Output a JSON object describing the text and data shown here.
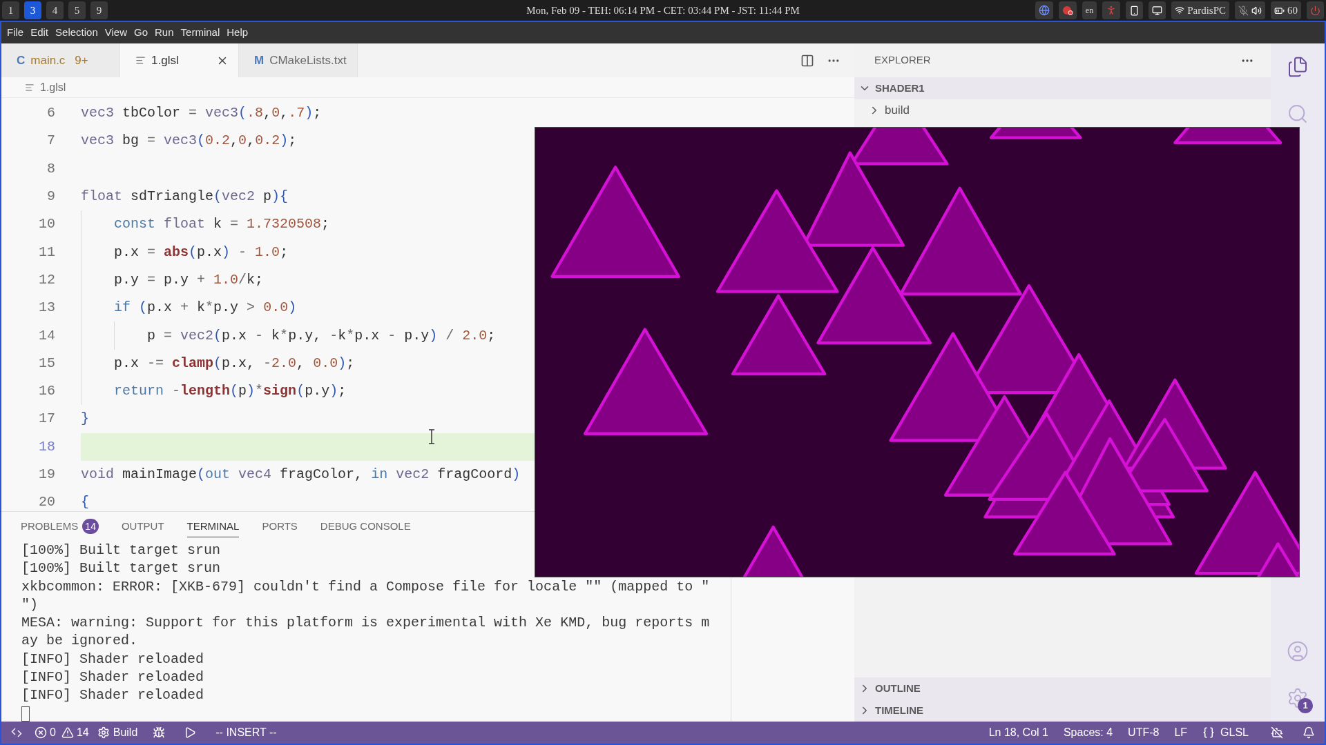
{
  "top_bar": {
    "workspaces": [
      {
        "label": "1",
        "selected": false
      },
      {
        "label": "3",
        "selected": true
      },
      {
        "label": "4",
        "selected": false
      },
      {
        "label": "5",
        "selected": false
      },
      {
        "label": "9",
        "selected": false
      }
    ],
    "clock": "Mon, Feb 09 - TEH: 06:14 PM - CET: 03:44 PM - JST: 11:44 PM",
    "keyboard_layout": "en",
    "network": "PardisPC",
    "battery": "60"
  },
  "menu": [
    "File",
    "Edit",
    "Selection",
    "View",
    "Go",
    "Run",
    "Terminal",
    "Help"
  ],
  "editor": {
    "tabs": [
      {
        "kind": "letter",
        "icon": "C",
        "label": "main.c",
        "badge": "9+",
        "has_problems": true,
        "selected": false
      },
      {
        "kind": "lines",
        "label": "1.glsl",
        "has_problems": false,
        "selected": true
      },
      {
        "kind": "letter",
        "icon": "M",
        "label": "CMakeLists.txt",
        "has_problems": false,
        "selected": false
      }
    ],
    "breadcrumb": "1.glsl",
    "lines": [
      {
        "number": "6",
        "current": false,
        "tokens": [
          {
            "text": "vec3",
            "kind": "type"
          },
          {
            "text": " tbColor ",
            "kind": "ident"
          },
          {
            "text": "= ",
            "kind": "op"
          },
          {
            "text": "vec3",
            "kind": "type"
          },
          {
            "text": "(",
            "kind": "bracket"
          },
          {
            "text": ".8",
            "kind": "number"
          },
          {
            "text": ",",
            "kind": "punct"
          },
          {
            "text": "0",
            "kind": "number"
          },
          {
            "text": ",",
            "kind": "punct"
          },
          {
            "text": ".7",
            "kind": "number"
          },
          {
            "text": ")",
            "kind": "bracket"
          },
          {
            "text": ";",
            "kind": "punct"
          }
        ]
      },
      {
        "number": "7",
        "current": false,
        "tokens": [
          {
            "text": "vec3",
            "kind": "type"
          },
          {
            "text": " bg ",
            "kind": "ident"
          },
          {
            "text": "= ",
            "kind": "op"
          },
          {
            "text": "vec3",
            "kind": "type"
          },
          {
            "text": "(",
            "kind": "bracket"
          },
          {
            "text": "0.2",
            "kind": "number"
          },
          {
            "text": ",",
            "kind": "punct"
          },
          {
            "text": "0",
            "kind": "number"
          },
          {
            "text": ",",
            "kind": "punct"
          },
          {
            "text": "0.2",
            "kind": "number"
          },
          {
            "text": ")",
            "kind": "bracket"
          },
          {
            "text": ";",
            "kind": "punct"
          }
        ]
      },
      {
        "number": "8",
        "current": false
      },
      {
        "number": "9",
        "current": false,
        "tokens": [
          {
            "text": "float",
            "kind": "type"
          },
          {
            "text": " sdTriangle",
            "kind": "ident"
          },
          {
            "text": "(",
            "kind": "bracket"
          },
          {
            "text": "vec2",
            "kind": "type"
          },
          {
            "text": " p",
            "kind": "ident"
          },
          {
            "text": "){",
            "kind": "bracket"
          }
        ],
        "children": [
          {
            "number": "10",
            "current": false,
            "tokens": [
              {
                "text": "const ",
                "kind": "keyword"
              },
              {
                "text": "float",
                "kind": "type"
              },
              {
                "text": " k ",
                "kind": "ident"
              },
              {
                "text": "= ",
                "kind": "op"
              },
              {
                "text": "1.7320508",
                "kind": "number"
              },
              {
                "text": ";",
                "kind": "punct"
              }
            ]
          },
          {
            "number": "11",
            "current": false,
            "tokens": [
              {
                "text": "p.x ",
                "kind": "ident"
              },
              {
                "text": "= ",
                "kind": "op"
              },
              {
                "text": "abs",
                "kind": "builtin"
              },
              {
                "text": "(",
                "kind": "bracket"
              },
              {
                "text": "p.x",
                "kind": "ident"
              },
              {
                "text": ")",
                "kind": "bracket"
              },
              {
                "text": " - ",
                "kind": "op"
              },
              {
                "text": "1.0",
                "kind": "number"
              },
              {
                "text": ";",
                "kind": "punct"
              }
            ]
          },
          {
            "number": "12",
            "current": false,
            "tokens": [
              {
                "text": "p.y ",
                "kind": "ident"
              },
              {
                "text": "= ",
                "kind": "op"
              },
              {
                "text": "p.y ",
                "kind": "ident"
              },
              {
                "text": "+ ",
                "kind": "op"
              },
              {
                "text": "1.0",
                "kind": "number"
              },
              {
                "text": "/",
                "kind": "op"
              },
              {
                "text": "k",
                "kind": "ident"
              },
              {
                "text": ";",
                "kind": "punct"
              }
            ]
          },
          {
            "number": "13",
            "current": false,
            "tokens": [
              {
                "text": "if ",
                "kind": "keyword"
              },
              {
                "text": "(",
                "kind": "bracket"
              },
              {
                "text": "p.x ",
                "kind": "ident"
              },
              {
                "text": "+ ",
                "kind": "op"
              },
              {
                "text": "k",
                "kind": "ident"
              },
              {
                "text": "*",
                "kind": "op"
              },
              {
                "text": "p.y ",
                "kind": "ident"
              },
              {
                "text": "> ",
                "kind": "op"
              },
              {
                "text": "0.0",
                "kind": "number"
              },
              {
                "text": ")",
                "kind": "bracket"
              }
            ],
            "children": [
              {
                "number": "14",
                "current": false,
                "tokens": [
                  {
                    "text": "p ",
                    "kind": "ident"
                  },
                  {
                    "text": "= ",
                    "kind": "op"
                  },
                  {
                    "text": "vec2",
                    "kind": "type"
                  },
                  {
                    "text": "(",
                    "kind": "bracket"
                  },
                  {
                    "text": "p.x ",
                    "kind": "ident"
                  },
                  {
                    "text": "- ",
                    "kind": "op"
                  },
                  {
                    "text": "k",
                    "kind": "ident"
                  },
                  {
                    "text": "*",
                    "kind": "op"
                  },
                  {
                    "text": "p.y, ",
                    "kind": "ident"
                  },
                  {
                    "text": "-",
                    "kind": "op"
                  },
                  {
                    "text": "k",
                    "kind": "ident"
                  },
                  {
                    "text": "*",
                    "kind": "op"
                  },
                  {
                    "text": "p.x ",
                    "kind": "ident"
                  },
                  {
                    "text": "- ",
                    "kind": "op"
                  },
                  {
                    "text": "p.y",
                    "kind": "ident"
                  },
                  {
                    "text": ")",
                    "kind": "bracket"
                  },
                  {
                    "text": " / ",
                    "kind": "op"
                  },
                  {
                    "text": "2.0",
                    "kind": "number"
                  },
                  {
                    "text": ";",
                    "kind": "punct"
                  }
                ]
              }
            ]
          },
          {
            "number": "15",
            "current": false,
            "tokens": [
              {
                "text": "p.x ",
                "kind": "ident"
              },
              {
                "text": "-= ",
                "kind": "op"
              },
              {
                "text": "clamp",
                "kind": "builtin"
              },
              {
                "text": "(",
                "kind": "bracket"
              },
              {
                "text": "p.x, ",
                "kind": "ident"
              },
              {
                "text": "-",
                "kind": "op"
              },
              {
                "text": "2.0",
                "kind": "number"
              },
              {
                "text": ", ",
                "kind": "punct"
              },
              {
                "text": "0.0",
                "kind": "number"
              },
              {
                "text": ")",
                "kind": "bracket"
              },
              {
                "text": ";",
                "kind": "punct"
              }
            ]
          },
          {
            "number": "16",
            "current": false,
            "tokens": [
              {
                "text": "return ",
                "kind": "keyword"
              },
              {
                "text": "-",
                "kind": "op"
              },
              {
                "text": "length",
                "kind": "builtin"
              },
              {
                "text": "(",
                "kind": "bracket"
              },
              {
                "text": "p",
                "kind": "ident"
              },
              {
                "text": ")",
                "kind": "bracket"
              },
              {
                "text": "*",
                "kind": "op"
              },
              {
                "text": "sign",
                "kind": "builtin"
              },
              {
                "text": "(",
                "kind": "bracket"
              },
              {
                "text": "p.y",
                "kind": "ident"
              },
              {
                "text": ")",
                "kind": "bracket"
              },
              {
                "text": ";",
                "kind": "punct"
              }
            ]
          }
        ]
      },
      {
        "number": "17",
        "current": false,
        "tokens": [
          {
            "text": "}",
            "kind": "bracket"
          }
        ]
      },
      {
        "number": "18",
        "current": true
      },
      {
        "number": "19",
        "current": false,
        "tokens": [
          {
            "text": "void",
            "kind": "type"
          },
          {
            "text": " mainImage",
            "kind": "ident"
          },
          {
            "text": "(",
            "kind": "bracket"
          },
          {
            "text": "out ",
            "kind": "keyword"
          },
          {
            "text": "vec4",
            "kind": "type"
          },
          {
            "text": " fragColor, ",
            "kind": "ident"
          },
          {
            "text": "in ",
            "kind": "keyword"
          },
          {
            "text": "vec2",
            "kind": "type"
          },
          {
            "text": " fragCoord",
            "kind": "ident"
          },
          {
            "text": ")",
            "kind": "bracket"
          }
        ]
      },
      {
        "number": "20",
        "current": false,
        "tokens": [
          {
            "text": "{",
            "kind": "bracket"
          }
        ]
      }
    ]
  },
  "panel": {
    "tabs": [
      {
        "label": "PROBLEMS",
        "badge": "14",
        "selected": false
      },
      {
        "label": "OUTPUT",
        "selected": false
      },
      {
        "label": "TERMINAL",
        "selected": true
      },
      {
        "label": "PORTS",
        "selected": false
      },
      {
        "label": "DEBUG CONSOLE",
        "selected": false
      }
    ],
    "terminal_lines": [
      "[100%] Built target srun",
      "[100%] Built target srun",
      "xkbcommon: ERROR: [XKB-679] couldn't find a Compose file for locale \"\" (mapped to \"",
      "\")",
      "MESA: warning: Support for this platform is experimental with Xe KMD, bug reports m",
      "ay be ignored.",
      "[INFO] Shader reloaded",
      "[INFO] Shader reloaded",
      "[INFO] Shader reloaded"
    ]
  },
  "sidebar": {
    "title": "EXPLORER",
    "sections": [
      {
        "label": "SHADER1",
        "expanded": true,
        "children": [
          {
            "label": "build",
            "expanded": false
          }
        ]
      },
      {
        "label": "OUTLINE",
        "expanded": false
      },
      {
        "label": "TIMELINE",
        "expanded": false
      }
    ]
  },
  "activity_bar": {
    "items": [
      {
        "kind": "files",
        "selected": true
      },
      {
        "kind": "search",
        "selected": false
      }
    ],
    "settings_badge": "1"
  },
  "status_bar": {
    "errors": "0",
    "warnings": "14",
    "task": "Build",
    "mode": "-- INSERT --",
    "cursor": "Ln 18, Col 1",
    "indentation": "Spaces: 4",
    "encoding": "UTF-8",
    "line_ending": "LF",
    "language": "GLSL"
  }
}
